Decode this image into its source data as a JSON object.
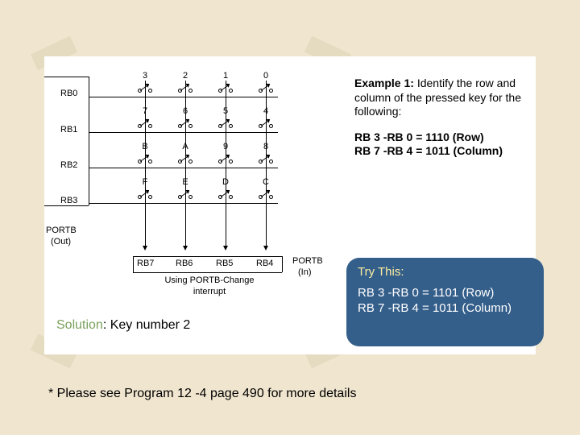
{
  "diagram": {
    "row_pins": [
      "RB0",
      "RB1",
      "RB2",
      "RB3"
    ],
    "col_pins": [
      "RB7",
      "RB6",
      "RB5",
      "RB4"
    ],
    "keys": [
      [
        "3",
        "2",
        "1",
        "0"
      ],
      [
        "7",
        "6",
        "5",
        "4"
      ],
      [
        "B",
        "A",
        "9",
        "8"
      ],
      [
        "F",
        "E",
        "D",
        "C"
      ]
    ],
    "left_port_label": "PORTB",
    "left_port_sub": "(Out)",
    "right_port_label": "PORTB",
    "right_port_sub": "(In)",
    "caption_line1": "Using PORTB-Change",
    "caption_line2": "interrupt"
  },
  "example": {
    "heading": "Example 1:",
    "prompt": "Identify the row and column of the pressed key for the following:",
    "row_eq": "RB 3 -RB 0 = 1110 (Row)",
    "col_eq": "RB 7 -RB 4 = 1011 (Column)"
  },
  "trythis": {
    "title": "Try This:",
    "row_eq": "RB 3 -RB 0 = 1101 (Row)",
    "col_eq": "RB 7 -RB 4 = 1011 (Column)"
  },
  "solution": {
    "label": "Solution",
    "text": ": Key number 2"
  },
  "footnote": "* Please see Program 12 -4 page 490 for more details"
}
